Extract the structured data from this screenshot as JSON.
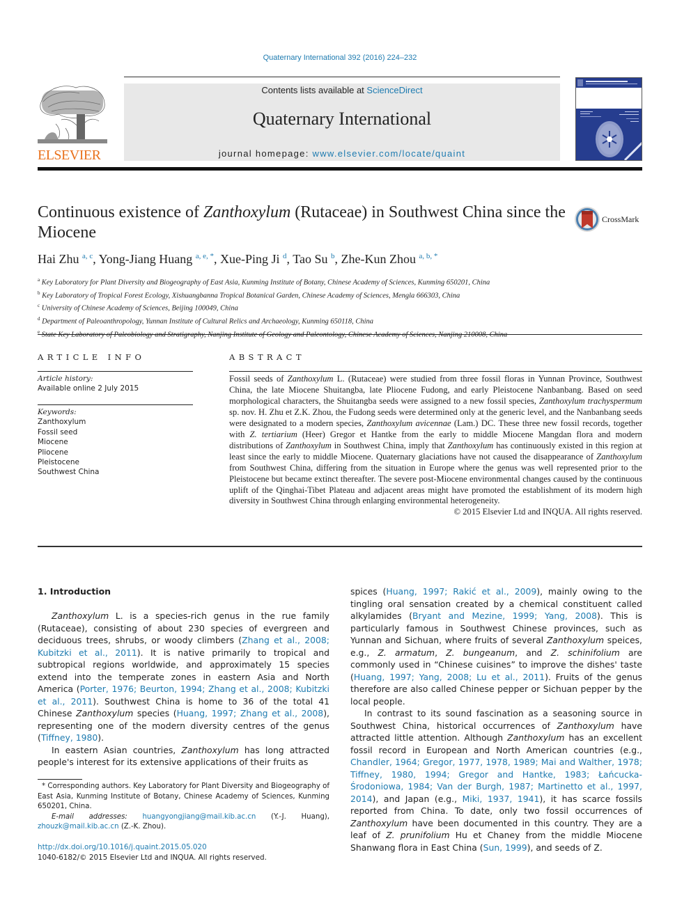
{
  "journal_citation": "Quaternary International 392 (2016) 224–232",
  "masthead": {
    "contents_prefix": "Contents lists available at ",
    "contents_link": "ScienceDirect",
    "journal_name": "Quaternary International",
    "homepage_prefix": "journal homepage: ",
    "homepage_link": "www.elsevier.com/locate/quaint"
  },
  "publisher_logo": {
    "icon": "elsevier-tree-icon",
    "wordmark": "ELSEVIER",
    "color": "#e9711c"
  },
  "cover": {
    "icon": "journal-cover-image",
    "color": "#263d8f"
  },
  "crossmark": {
    "icon": "crossmark-icon",
    "label": "CrossMark"
  },
  "article": {
    "title_pre": "Continuous existence of ",
    "title_italic": "Zanthoxylum",
    "title_post": " (Rutaceae) in Southwest China since the Miocene",
    "authors": [
      {
        "name": "Hai Zhu",
        "sup": "a, c",
        "sep": ", "
      },
      {
        "name": "Yong-Jiang Huang",
        "sup": "a, e, *",
        "sep": ", "
      },
      {
        "name": "Xue-Ping Ji",
        "sup": "d",
        "sep": ", "
      },
      {
        "name": "Tao Su",
        "sup": "b",
        "sep": ", "
      },
      {
        "name": "Zhe-Kun Zhou",
        "sup": "a, b, *",
        "sep": ""
      }
    ],
    "affiliations": [
      {
        "key": "a",
        "text": "Key Laboratory for Plant Diversity and Biogeography of East Asia, Kunming Institute of Botany, Chinese Academy of Sciences, Kunming 650201, China"
      },
      {
        "key": "b",
        "text": "Key Laboratory of Tropical Forest Ecology, Xishuangbanna Tropical Botanical Garden, Chinese Academy of Sciences, Mengla 666303, China"
      },
      {
        "key": "c",
        "text": "University of Chinese Academy of Sciences, Beijing 100049, China"
      },
      {
        "key": "d",
        "text": "Department of Paleoanthropology, Yunnan Institute of Cultural Relics and Archaeology, Kunming 650118, China"
      },
      {
        "key": "e",
        "text": "State Key Laboratory of Paleobiology and Stratigraphy, Nanjing Institute of Geology and Paleontology, Chinese Academy of Sciences, Nanjing 210008, China"
      }
    ]
  },
  "article_info": {
    "label": "ARTICLE INFO",
    "history_label": "Article history:",
    "history_value": "Available online 2 July 2015",
    "keywords_label": "Keywords:",
    "keywords": [
      "Zanthoxylum",
      "Fossil seed",
      "Miocene",
      "Pliocene",
      "Pleistocene",
      "Southwest China"
    ]
  },
  "abstract": {
    "label": "ABSTRACT",
    "segments": [
      {
        "t": "Fossil seeds of "
      },
      {
        "i": "Zanthoxylum"
      },
      {
        "t": " L. (Rutaceae) were studied from three fossil floras in Yunnan Province, Southwest China, the late Miocene Shuitangba, late Pliocene Fudong, and early Pleistocene Nanbanbang. Based on seed morphological characters, the Shuitangba seeds were assigned to a new fossil species, "
      },
      {
        "i": "Zanthoxylum trachyspermum"
      },
      {
        "t": " sp. nov. H. Zhu et Z.K. Zhou, the Fudong seeds were determined only at the generic level, and the Nanbanbang seeds were designated to a modern species, "
      },
      {
        "i": "Zanthoxylum avicennae"
      },
      {
        "t": " (Lam.) DC. These three new fossil records, together with "
      },
      {
        "i": "Z. tertiarium"
      },
      {
        "t": " (Heer) Gregor et Hantke from the early to middle Miocene Mangdan flora and modern distributions of "
      },
      {
        "i": "Zanthoxylum"
      },
      {
        "t": " in Southwest China, imply that "
      },
      {
        "i": "Zanthoxylum"
      },
      {
        "t": " has continuously existed in this region at least since the early to middle Miocene. Quaternary glaciations have not caused the disappearance of "
      },
      {
        "i": "Zanthoxylum"
      },
      {
        "t": " from Southwest China, differing from the situation in Europe where the genus was well represented prior to the Pleistocene but became extinct thereafter. The severe post-Miocene environmental changes caused by the continuous uplift of the Qinghai-Tibet Plateau and adjacent areas might have promoted the establishment of its modern high diversity in Southwest China through enlarging environmental heterogeneity."
      }
    ],
    "copyright": "© 2015 Elsevier Ltd and INQUA. All rights reserved."
  },
  "introduction": {
    "heading": "1.  Introduction",
    "left_paragraphs": [
      [
        {
          "i": "Zanthoxylum"
        },
        {
          "t": " L. is a species-rich genus in the rue family (Rutaceae), consisting of about 230 species of evergreen and deciduous trees, shrubs, or woody climbers ("
        },
        {
          "l": "Zhang et al., 2008; Kubitzki et al., 2011"
        },
        {
          "t": "). It is native primarily to tropical and subtropical regions worldwide, and approximately 15 species extend into the temperate zones in eastern Asia and North America ("
        },
        {
          "l": "Porter, 1976; Beurton, 1994; Zhang et al., 2008; Kubitzki et al., 2011"
        },
        {
          "t": "). Southwest China is home to 36 of the total 41 Chinese "
        },
        {
          "i": "Zanthoxylum"
        },
        {
          "t": " species ("
        },
        {
          "l": "Huang, 1997; Zhang et al., 2008"
        },
        {
          "t": "), representing one of the modern diversity centres of the genus ("
        },
        {
          "l": "Tiffney, 1980"
        },
        {
          "t": ")."
        }
      ],
      [
        {
          "t": "In eastern Asian countries, "
        },
        {
          "i": "Zanthoxylum"
        },
        {
          "t": " has long attracted people's interest for its extensive applications of their fruits as"
        }
      ]
    ],
    "right_paragraphs": [
      [
        {
          "t": "spices ("
        },
        {
          "l": "Huang, 1997; Rakić et al., 2009"
        },
        {
          "t": "), mainly owing to the tingling oral sensation created by a chemical constituent called alkylamides ("
        },
        {
          "l": "Bryant and Mezine, 1999; Yang, 2008"
        },
        {
          "t": "). This is particularly famous in Southwest Chinese provinces, such as Yunnan and Sichuan, where fruits of several "
        },
        {
          "i": "Zanthoxylum"
        },
        {
          "t": " speices, e.g., "
        },
        {
          "i": "Z. armatum"
        },
        {
          "t": ", "
        },
        {
          "i": "Z. bungeanum"
        },
        {
          "t": ", and "
        },
        {
          "i": "Z. schinifolium"
        },
        {
          "t": " are commonly used in “Chinese cuisines” to improve the dishes' taste ("
        },
        {
          "l": "Huang, 1997; Yang, 2008; Lu et al., 2011"
        },
        {
          "t": "). Fruits of the genus therefore are also called Chinese pepper or Sichuan pepper by the local people."
        }
      ],
      [
        {
          "t": "In contrast to its sound fascination as a seasoning source in Southwest China, historical occurrences of "
        },
        {
          "i": "Zanthoxylum"
        },
        {
          "t": " have attracted little attention. Although "
        },
        {
          "i": "Zanthoxylum"
        },
        {
          "t": " has an excellent fossil record in European and North American countries (e.g., "
        },
        {
          "l": "Chandler, 1964; Gregor, 1977, 1978, 1989; Mai and Walther, 1978; Tiffney, 1980, 1994; Gregor and Hantke, 1983; Łańcucka-Środoniowa, 1984; Van der Burgh, 1987; Martinetto et al., 1997, 2014"
        },
        {
          "t": "), and Japan (e.g., "
        },
        {
          "l": "Miki, 1937, 1941"
        },
        {
          "t": "), it has scarce fossils reported from China. To date, only two fossil occurrences of "
        },
        {
          "i": "Zanthoxylum"
        },
        {
          "t": " have been documented in this country. They are a leaf of "
        },
        {
          "i": "Z. prunifolium"
        },
        {
          "t": " Hu et Chaney from the middle Miocene Shanwang flora in East China ("
        },
        {
          "l": "Sun, 1999"
        },
        {
          "t": "), and seeds of Z."
        }
      ]
    ]
  },
  "footnotes": {
    "star_text": "* Corresponding authors. Key Laboratory for Plant Diversity and Biogeography of East Asia, Kunming Institute of Botany, Chinese Academy of Sciences, Kunming 650201, China.",
    "email_label": "E-mail addresses:",
    "email_1": "huangyongjiang@mail.kib.ac.cn",
    "email_1_owner": " (Y.-J. Huang), ",
    "email_2": "zhouzk@mail.kib.ac.cn",
    "email_2_owner": " (Z.-K. Zhou)."
  },
  "doi": "http://dx.doi.org/10.1016/j.quaint.2015.05.020",
  "issn_line": "1040-6182/© 2015 Elsevier Ltd and INQUA. All rights reserved."
}
